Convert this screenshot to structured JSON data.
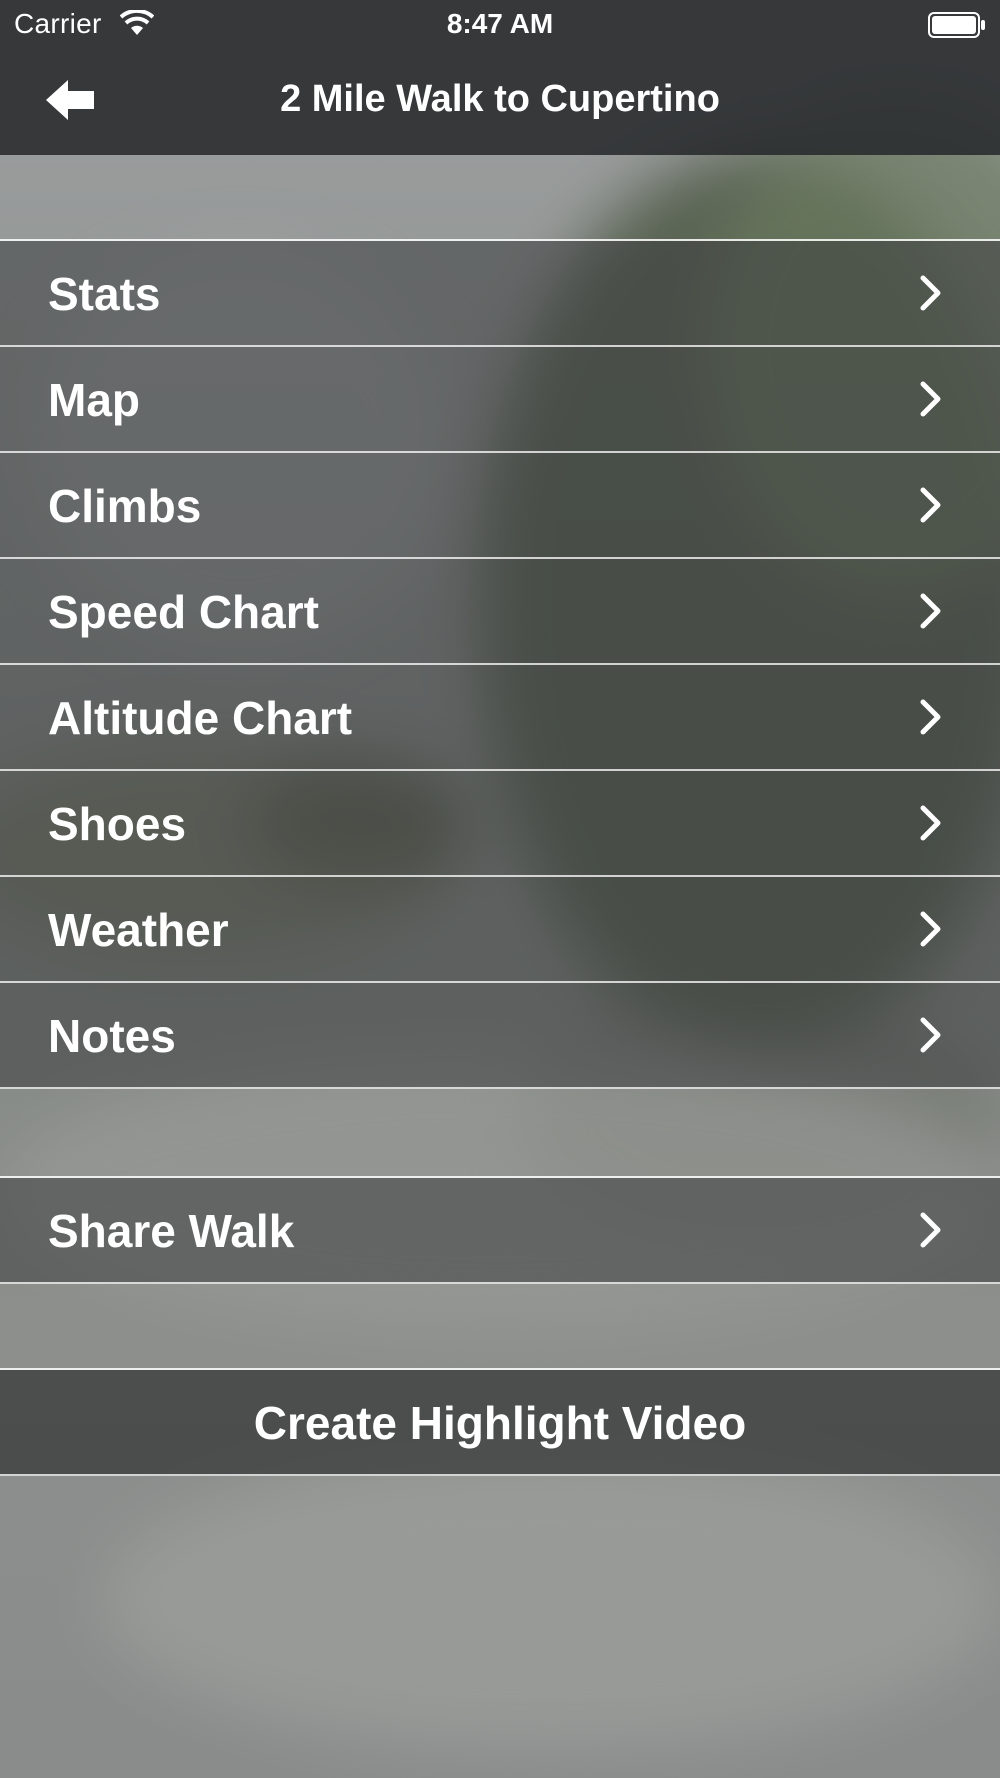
{
  "status_bar": {
    "carrier": "Carrier",
    "time": "8:47 AM",
    "wifi_icon": "wifi-icon",
    "battery_icon": "battery-icon"
  },
  "nav_bar": {
    "back_icon": "arrow-left-icon",
    "title": "2 Mile Walk to Cupertino"
  },
  "menu": {
    "items": [
      {
        "label": "Stats",
        "icon": "chevron-right-icon"
      },
      {
        "label": "Map",
        "icon": "chevron-right-icon"
      },
      {
        "label": "Climbs",
        "icon": "chevron-right-icon"
      },
      {
        "label": "Speed Chart",
        "icon": "chevron-right-icon"
      },
      {
        "label": "Altitude Chart",
        "icon": "chevron-right-icon"
      },
      {
        "label": "Shoes",
        "icon": "chevron-right-icon"
      },
      {
        "label": "Weather",
        "icon": "chevron-right-icon"
      },
      {
        "label": "Notes",
        "icon": "chevron-right-icon"
      }
    ]
  },
  "share": {
    "label": "Share Walk",
    "icon": "chevron-right-icon"
  },
  "highlight": {
    "label": "Create Highlight Video"
  },
  "colors": {
    "text": "#ffffff",
    "nav_background": "#282a2c",
    "row_background": "#3c3e3f",
    "separator": "#ffffff"
  }
}
